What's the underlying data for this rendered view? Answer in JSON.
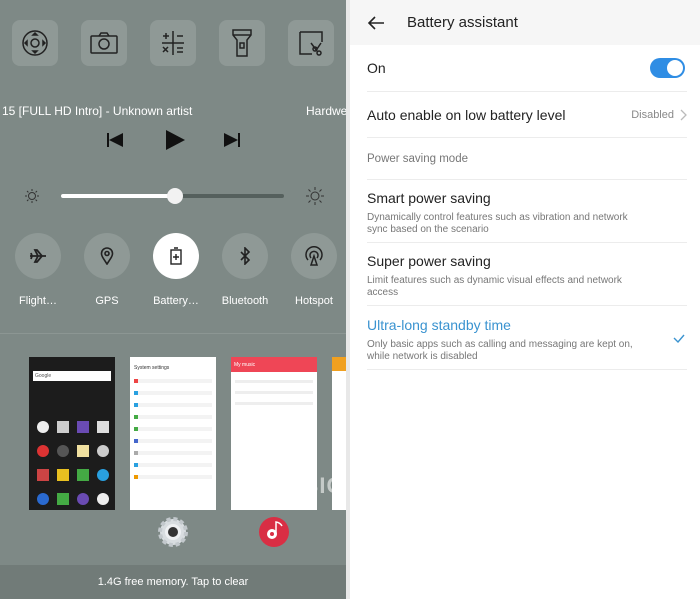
{
  "left_panel": {
    "shortcuts": [
      {
        "icon": "remote-control-icon"
      },
      {
        "icon": "camera-icon"
      },
      {
        "icon": "calculator-icon"
      },
      {
        "icon": "flashlight-icon"
      },
      {
        "icon": "screenshot-icon"
      }
    ],
    "media": {
      "title": "15 [FULL HD   Intro] - Unknown artist",
      "title_right": "Hardwe"
    },
    "brightness": {
      "level_percent": 51
    },
    "toggles": [
      {
        "label": "Flight…",
        "icon": "airplane-icon",
        "active": false
      },
      {
        "label": "GPS",
        "icon": "location-icon",
        "active": false
      },
      {
        "label": "Battery…",
        "icon": "battery-icon",
        "active": true
      },
      {
        "label": "Bluetooth",
        "icon": "bluetooth-icon",
        "active": false
      },
      {
        "label": "Hotspot",
        "icon": "hotspot-icon",
        "active": false
      }
    ],
    "recent_apps": [
      {
        "name": "home-screen",
        "search": "Google"
      },
      {
        "name": "system-settings",
        "title": "System settings"
      },
      {
        "name": "music",
        "title": "My music"
      }
    ],
    "memory_text": "1.4G free memory. Tap to clear",
    "watermark": "MOBIGYAAN"
  },
  "right_panel": {
    "header": {
      "title": "Battery assistant"
    },
    "on_row": {
      "label": "On",
      "enabled": true
    },
    "auto_row": {
      "label": "Auto enable on low battery level",
      "value": "Disabled"
    },
    "section_label": "Power saving mode",
    "modes": [
      {
        "title": "Smart power saving",
        "desc": "Dynamically control features such as vibration and network sync based on the scenario",
        "selected": false
      },
      {
        "title": "Super power saving",
        "desc": "Limit features such as dynamic visual effects and network access",
        "selected": false
      },
      {
        "title": "Ultra-long standby time",
        "desc": "Only basic apps such as calling and messaging are kept on, while network is disabled",
        "selected": true
      }
    ],
    "colors": {
      "accent": "#2f8de4",
      "selected_text": "#3a93d0"
    }
  }
}
